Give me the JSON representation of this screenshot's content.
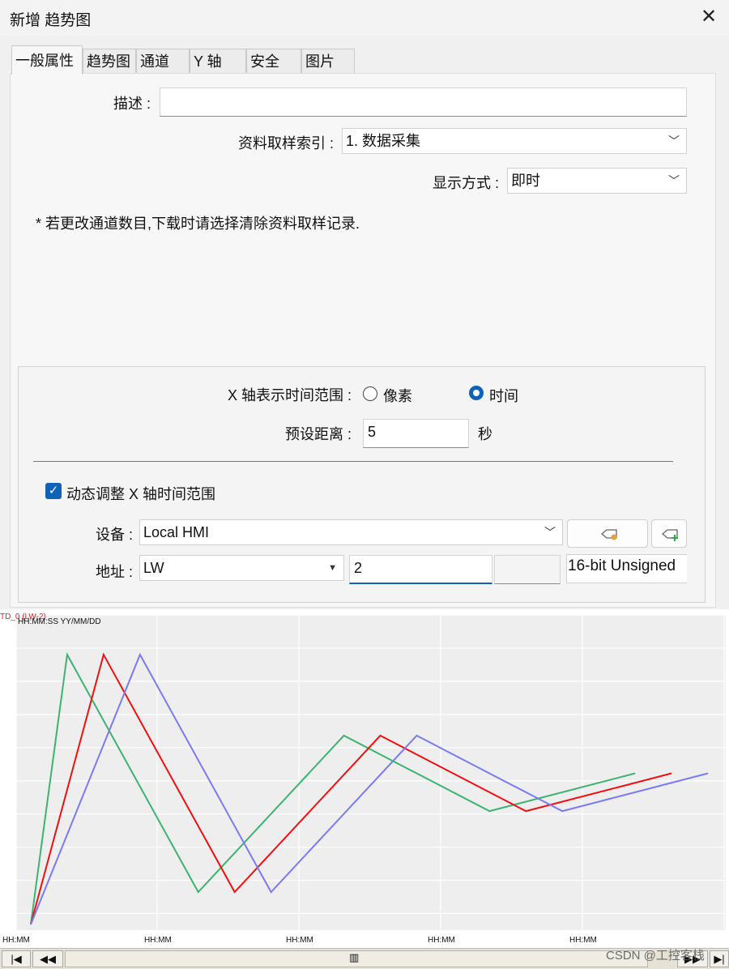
{
  "window": {
    "title": "新增 趋势图",
    "close_symbol": "✕"
  },
  "tabs": [
    {
      "label": "一般属性",
      "active": true
    },
    {
      "label": "趋势图"
    },
    {
      "label": "通道"
    },
    {
      "label": "Y 轴"
    },
    {
      "label": "安全"
    },
    {
      "label": "图片"
    }
  ],
  "general": {
    "description_label": "描述 :",
    "description_value": "",
    "sampling_index_label": "资料取样索引 :",
    "sampling_index_value": "1. 数据采集",
    "display_mode_label": "显示方式 :",
    "display_mode_value": "即时",
    "note": "* 若更改通道数目,下载时请选择清除资料取样记录."
  },
  "xaxis": {
    "range_label": "X 轴表示时间范围 :",
    "option_pixel": "像素",
    "option_time": "时间",
    "selected": "时间",
    "preset_distance_label": "预设距离 :",
    "preset_distance_value": "5",
    "preset_distance_unit": "秒",
    "dynamic_label": "动态调整 X 轴时间范围",
    "dynamic_checked": true,
    "device_label": "设备 :",
    "device_value": "Local HMI",
    "address_label": "地址 :",
    "address_type": "LW",
    "address_value": "2",
    "data_format": "16-bit Unsigned"
  },
  "chart_data": {
    "type": "line",
    "title": "TD_0 (LW-2)",
    "subtitle": "HH:MM:SS YY/MM/DD",
    "x_tick_labels": [
      "HH:MM",
      "HH:MM",
      "HH:MM",
      "HH:MM",
      "HH:MM"
    ],
    "x": [
      0,
      1,
      2,
      3,
      4,
      5,
      6,
      7,
      8,
      9
    ],
    "ylim": [
      0,
      100
    ],
    "grid": true,
    "series": [
      {
        "color": "#3cb371",
        "values": [
          0,
          100,
          null,
          null,
          null,
          null,
          null,
          null,
          null,
          null
        ]
      },
      {
        "color": "#3cb371",
        "x": [
          0,
          0.5,
          2.3,
          4.3,
          6.3,
          8.3
        ],
        "values": [
          0,
          100,
          12,
          70,
          42,
          56
        ]
      },
      {
        "color": "#ee1111",
        "x": [
          0,
          1.0,
          2.8,
          4.8,
          6.8,
          8.8
        ],
        "values": [
          0,
          100,
          12,
          70,
          42,
          56
        ]
      },
      {
        "color": "#7b7bf0",
        "x": [
          0,
          1.5,
          3.3,
          5.3,
          7.3,
          9.3
        ],
        "values": [
          0,
          100,
          12,
          70,
          42,
          56
        ]
      }
    ]
  },
  "scrollbar": {
    "first": "|◀",
    "prev": "◀◀",
    "next": "▶▶",
    "last": "▶|",
    "thumb_grip": "▥"
  },
  "watermark": "CSDN @工控客栈"
}
